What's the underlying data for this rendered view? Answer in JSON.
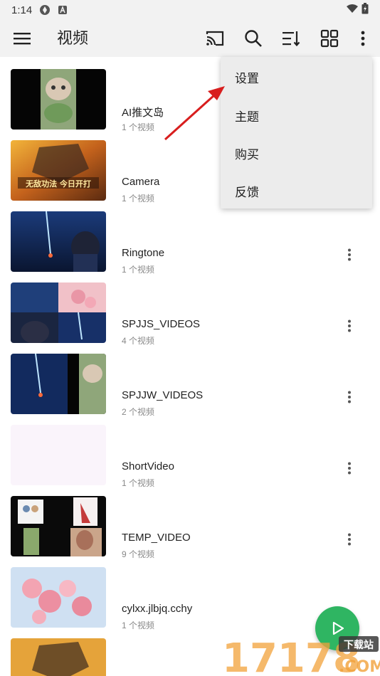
{
  "status": {
    "time": "1:14"
  },
  "appbar": {
    "title": "视频",
    "icons": [
      "menu-icon",
      "cast-icon",
      "search-icon",
      "sort-icon",
      "grid-view-icon",
      "more-vert-icon"
    ]
  },
  "menu": {
    "items": [
      {
        "label": "设置"
      },
      {
        "label": "主题"
      },
      {
        "label": "购买"
      },
      {
        "label": "反馈"
      }
    ]
  },
  "folders": [
    {
      "name": "AI推文岛",
      "count": "1 个视频"
    },
    {
      "name": "Camera",
      "count": "1 个视频"
    },
    {
      "name": "Ringtone",
      "count": "1 个视频"
    },
    {
      "name": "SPJJS_VIDEOS",
      "count": "4 个视频"
    },
    {
      "name": "SPJJW_VIDEOS",
      "count": "2 个视频"
    },
    {
      "name": "ShortVideo",
      "count": "1 个视频"
    },
    {
      "name": "TEMP_VIDEO",
      "count": "9 个视频"
    },
    {
      "name": "cylxx.jlbjq.cchy",
      "count": "1 个视频"
    },
    {
      "name": "",
      "count": ""
    }
  ],
  "thumb_banner_text": "无敌功法 今日开打",
  "watermark": {
    "number": "17178",
    "tag": "下载站",
    "domain": ".COM"
  },
  "colors": {
    "accent": "#2fb562",
    "arrow": "#d81e1e",
    "bar": "#f2f2f2"
  }
}
